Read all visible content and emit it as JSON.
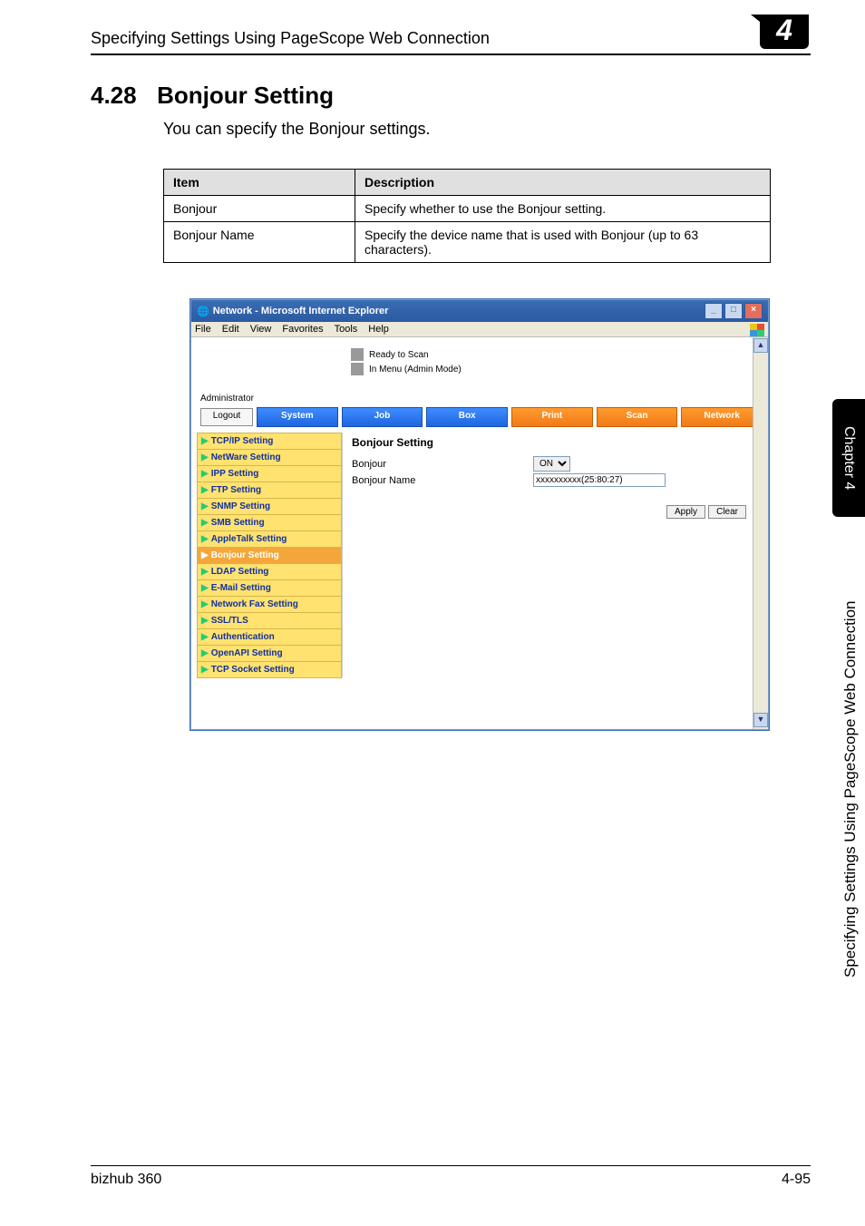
{
  "header": {
    "title": "Specifying Settings Using PageScope Web Connection"
  },
  "chapter_badge": "4",
  "section": {
    "number": "4.28",
    "title": "Bonjour Setting"
  },
  "intro_text": "You can specify the Bonjour settings.",
  "item_table": {
    "headers": {
      "col1": "Item",
      "col2": "Description"
    },
    "rows": [
      {
        "item": "Bonjour",
        "desc": "Specify whether to use the Bonjour setting."
      },
      {
        "item": "Bonjour Name",
        "desc": "Specify the device name that is used with Bonjour (up to 63 characters)."
      }
    ]
  },
  "ie_window": {
    "title": "Network - Microsoft Internet Explorer",
    "menu": {
      "file": "File",
      "edit": "Edit",
      "view": "View",
      "favorites": "Favorites",
      "tools": "Tools",
      "help": "Help"
    },
    "status": {
      "line1": "Ready to Scan",
      "line2": "In Menu (Admin Mode)"
    },
    "admin_label": "Administrator",
    "logout": "Logout",
    "tabs": {
      "system": "System",
      "job": "Job",
      "box": "Box",
      "print": "Print",
      "scan": "Scan",
      "network": "Network"
    },
    "sidebar": [
      {
        "label": "TCP/IP Setting",
        "selected": false
      },
      {
        "label": "NetWare Setting",
        "selected": false
      },
      {
        "label": "IPP Setting",
        "selected": false
      },
      {
        "label": "FTP Setting",
        "selected": false
      },
      {
        "label": "SNMP Setting",
        "selected": false
      },
      {
        "label": "SMB Setting",
        "selected": false
      },
      {
        "label": "AppleTalk Setting",
        "selected": false
      },
      {
        "label": "Bonjour Setting",
        "selected": true
      },
      {
        "label": "LDAP Setting",
        "selected": false
      },
      {
        "label": "E-Mail Setting",
        "selected": false
      },
      {
        "label": "Network Fax Setting",
        "selected": false
      },
      {
        "label": "SSL/TLS",
        "selected": false
      },
      {
        "label": "Authentication",
        "selected": false
      },
      {
        "label": "OpenAPI Setting",
        "selected": false
      },
      {
        "label": "TCP Socket Setting",
        "selected": false
      }
    ],
    "main": {
      "heading": "Bonjour Setting",
      "bonjour_label": "Bonjour",
      "bonjour_value": "ON",
      "bonjour_name_label": "Bonjour Name",
      "bonjour_name_value": "xxxxxxxxxx(25:80:27)",
      "apply": "Apply",
      "clear": "Clear"
    }
  },
  "side_tab": "Chapter 4",
  "side_vertical": "Specifying Settings Using PageScope Web Connection",
  "footer": {
    "left": "bizhub 360",
    "right": "4-95"
  }
}
